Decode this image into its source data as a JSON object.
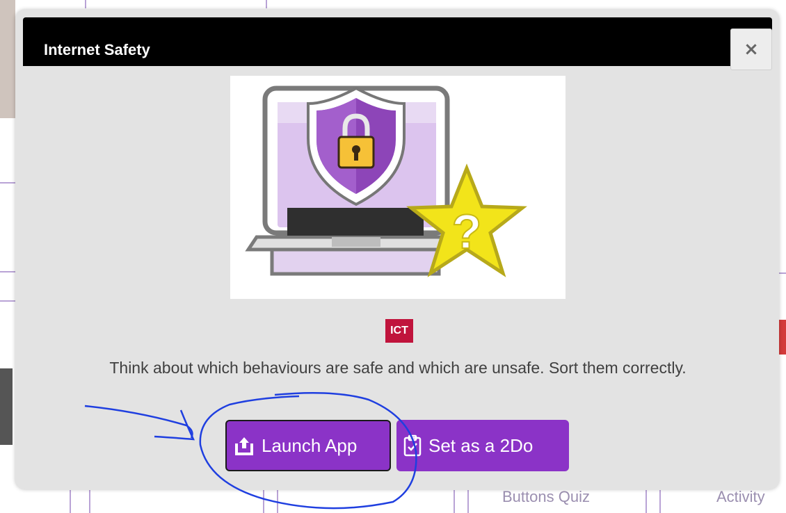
{
  "modal": {
    "title": "Internet Safety",
    "close_label": "×",
    "subject_badge": "ICT",
    "description": "Think about which behaviours are safe and which are unsafe. Sort them correctly.",
    "buttons": {
      "launch_label": "Launch App",
      "set_2do_label": "Set as a 2Do"
    }
  },
  "background": {
    "labels": [
      "Buttons Quiz",
      "Activity"
    ]
  },
  "colors": {
    "header": "#000000",
    "button": "#8b33c7",
    "badge": "#c0143c",
    "annotation_ink": "#1f3fe0"
  },
  "icons": {
    "launch": "launch-app-icon",
    "set_2do": "clipboard-check-icon",
    "close": "close-icon"
  }
}
